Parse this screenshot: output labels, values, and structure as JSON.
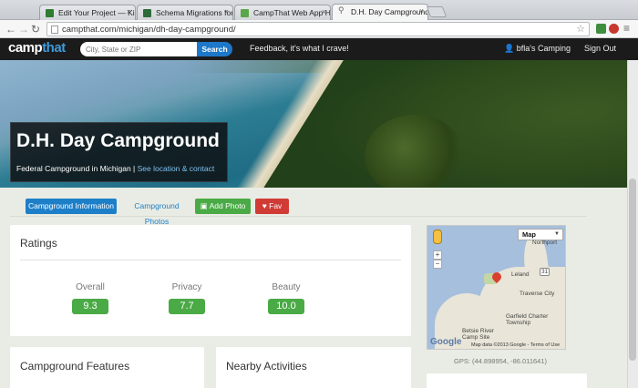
{
  "browser": {
    "tabs": [
      {
        "title": "Edit Your Project — Kickst",
        "favicon_color": "#2e7d32"
      },
      {
        "title": "Schema Migrations for Dja",
        "favicon_color": "#2e6b3a"
      },
      {
        "title": "CampThat Web App Helps",
        "favicon_color": "#5aa64a"
      },
      {
        "title": "D.H. Day Campground ~ M",
        "favicon_color": "#888888"
      }
    ],
    "url": "campthat.com/michigan/dh-day-campground/"
  },
  "site": {
    "logo_part1": "camp",
    "logo_part2": "that",
    "search_placeholder": "City, State or ZIP",
    "search_label": "Search",
    "feedback": "Feedback, it's what I crave!",
    "user": "bfla's Camping",
    "signout": "Sign Out"
  },
  "hero": {
    "title": "D.H. Day Campground",
    "subtitle": "Federal Campground in Michigan",
    "separator": " | ",
    "location_link": "See location & contact"
  },
  "actions": {
    "info": "Campground Information",
    "photos": "Campground Photos",
    "add_photo": "Add Photo",
    "fav": "Fav"
  },
  "ratings": {
    "title": "Ratings",
    "items": [
      {
        "label": "Overall",
        "score": "9.3"
      },
      {
        "label": "Privacy",
        "score": "7.7"
      },
      {
        "label": "Beauty",
        "score": "10.0"
      }
    ]
  },
  "sections": {
    "features": "Campground Features",
    "activities": "Nearby Activities"
  },
  "map": {
    "type": "Map",
    "zoom_in": "+",
    "zoom_out": "−",
    "towns": [
      "Northport",
      "Leland",
      "Traverse City",
      "Garfield Charter Township",
      "Betsie River Camp Site"
    ],
    "road": "31",
    "logo": "Google",
    "copyright": "Map data ©2013 Google - Terms of Use",
    "gps": "GPS: (44.898954, -86.011641)"
  },
  "colors": {
    "brand_blue": "#1e7fc9",
    "green": "#4aaa45",
    "red": "#d03b35",
    "nav_bg": "#1b1b1b"
  }
}
